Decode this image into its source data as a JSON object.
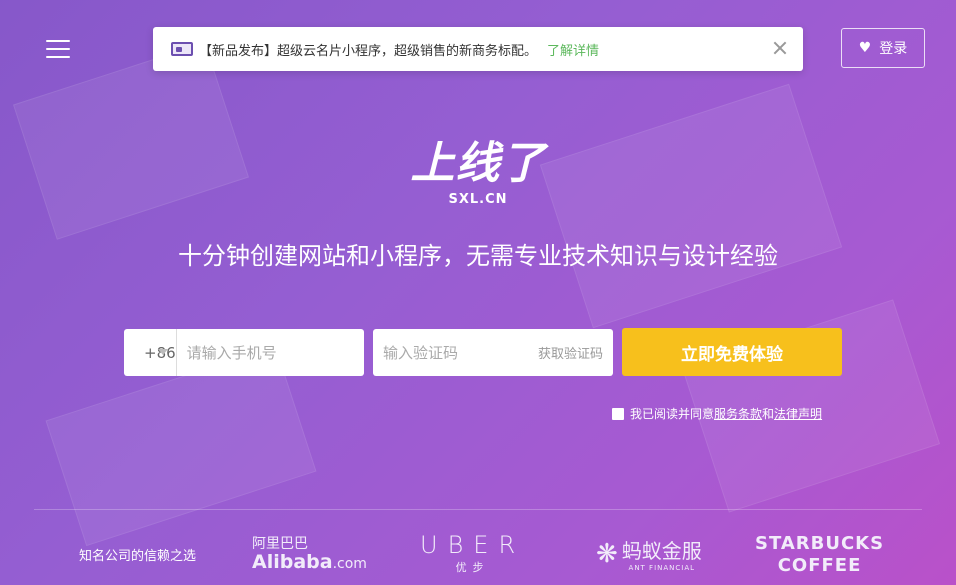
{
  "header": {
    "menu_icon": "hamburger-icon",
    "login_label": "登录",
    "login_icon": "heart-icon"
  },
  "notice": {
    "icon": "card-icon",
    "text": "【新品发布】超级云名片小程序，超级销售的新商务标配。",
    "link": "了解详情",
    "close_icon": "close-icon"
  },
  "logo": {
    "cn": "上线了",
    "en": "SXL.CN"
  },
  "headline": "十分钟创建网站和小程序，无需专业技术知识与设计经验",
  "signup": {
    "country_code": "+86",
    "phone_placeholder": "请输入手机号",
    "code_placeholder": "输入验证码",
    "get_code_label": "获取验证码",
    "cta_label": "立即免费体验",
    "agree_prefix": "我已阅读并同意",
    "terms_link": "服务条款",
    "and_text": "和",
    "legal_link": "法律声明"
  },
  "trust": {
    "label": "知名公司的信赖之选",
    "alibaba_cn": "阿里巴巴",
    "alibaba_en": "Alibaba",
    "alibaba_suffix": ".com",
    "uber_en": "UBER",
    "uber_cn": "优步",
    "ant_cn": "蚂蚁金服",
    "ant_en": "ANT FINANCIAL",
    "starbucks_l1": "STARBUCKS",
    "starbucks_l2": "COFFEE"
  },
  "colors": {
    "background": "#8f57d3",
    "cta": "#f7c01c",
    "link_green": "#5cb85c"
  }
}
